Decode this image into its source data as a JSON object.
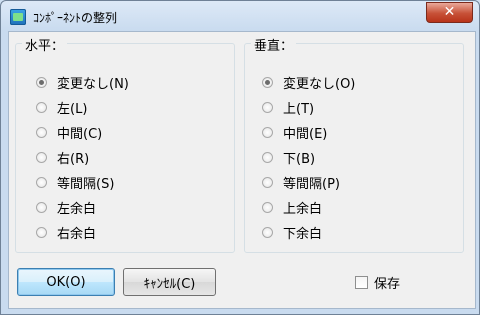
{
  "window": {
    "title": "ｺﾝﾎﾟｰﾈﾝﾄの整列",
    "close_glyph": "✕"
  },
  "horizontal": {
    "legend": "水平：",
    "options": [
      "変更なし(N)",
      "左(L)",
      "中間(C)",
      "右(R)",
      "等間隔(S)",
      "左余白",
      "右余白"
    ],
    "selected_index": 0
  },
  "vertical": {
    "legend": "垂直：",
    "options": [
      "変更なし(O)",
      "上(T)",
      "中間(E)",
      "下(B)",
      "等間隔(P)",
      "上余白",
      "下余白"
    ],
    "selected_index": 0
  },
  "buttons": {
    "ok": "OK(O)",
    "cancel": "ｷｬﾝｾﾙ(C)"
  },
  "save_checkbox": {
    "label": "保存",
    "checked": false
  },
  "icons": {
    "app": "app-icon",
    "close": "close-icon"
  },
  "colors": {
    "close_button": "#c75137",
    "default_button_border": "#3c7fb1",
    "client_bg": "#f0f0f0"
  }
}
